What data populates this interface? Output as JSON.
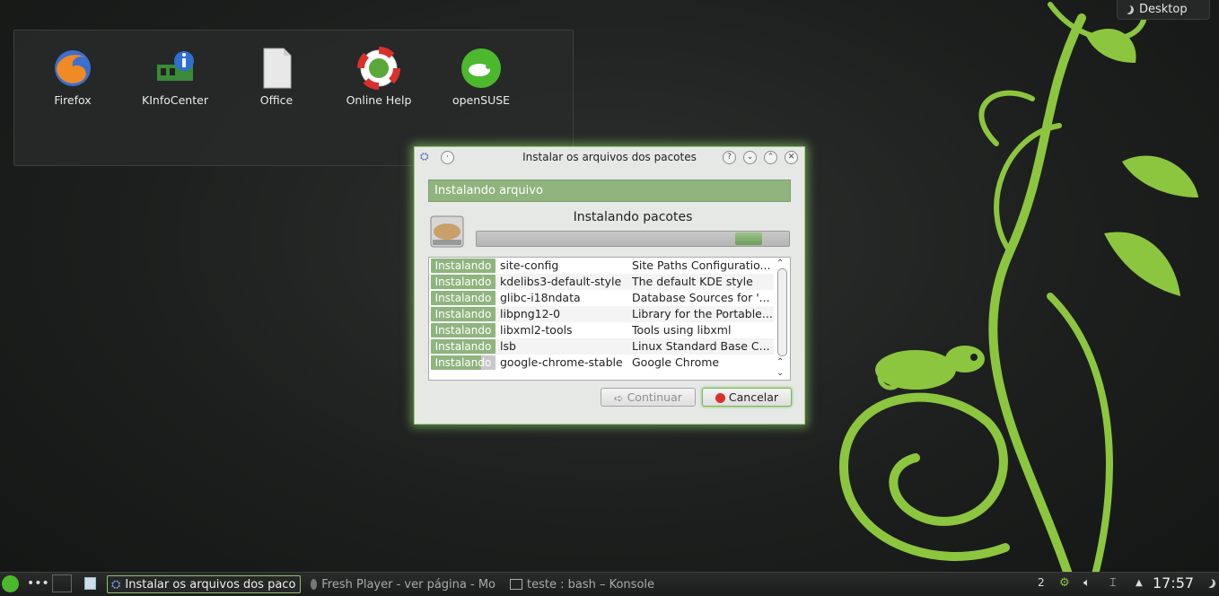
{
  "desktop": {
    "widget_label": "Desktop",
    "icons": [
      {
        "label": "Firefox"
      },
      {
        "label": "KInfoCenter"
      },
      {
        "label": "Office"
      },
      {
        "label": "Online Help"
      },
      {
        "label": "openSUSE"
      }
    ]
  },
  "dialog": {
    "title": "Instalar os arquivos dos pacotes",
    "help_glyph": "?",
    "status_text": "Instalando arquivo",
    "heading": "Instalando pacotes",
    "progress_fraction": 0.92,
    "packages": [
      {
        "status": "Instalando",
        "name": "site-config",
        "description": "Site Paths Configuratio..."
      },
      {
        "status": "Instalando",
        "name": "kdelibs3-default-style",
        "description": "The default KDE style"
      },
      {
        "status": "Instalando",
        "name": "glibc-i18ndata",
        "description": "Database Sources for '..."
      },
      {
        "status": "Instalando",
        "name": "libpng12-0",
        "description": "Library for the Portable..."
      },
      {
        "status": "Instalando",
        "name": "libxml2-tools",
        "description": "Tools using libxml"
      },
      {
        "status": "Instalando",
        "name": "lsb",
        "description": "Linux Standard Base C..."
      },
      {
        "status": "Instalando",
        "name": "google-chrome-stable",
        "description": "Google Chrome"
      }
    ],
    "continue_label": "Continuar",
    "cancel_label": "Cancelar"
  },
  "taskbar": {
    "tasks": [
      {
        "label": "Instalar os arquivos dos paco"
      },
      {
        "label": "Fresh Player - ver página - Mo"
      },
      {
        "label": "teste : bash – Konsole"
      }
    ],
    "desktop_count": "2",
    "clock": "17:57"
  },
  "colors": {
    "accent_green": "#8fb47e",
    "desktop_bg": "#1d1f1e",
    "swirl_green": "#8cc63f"
  }
}
